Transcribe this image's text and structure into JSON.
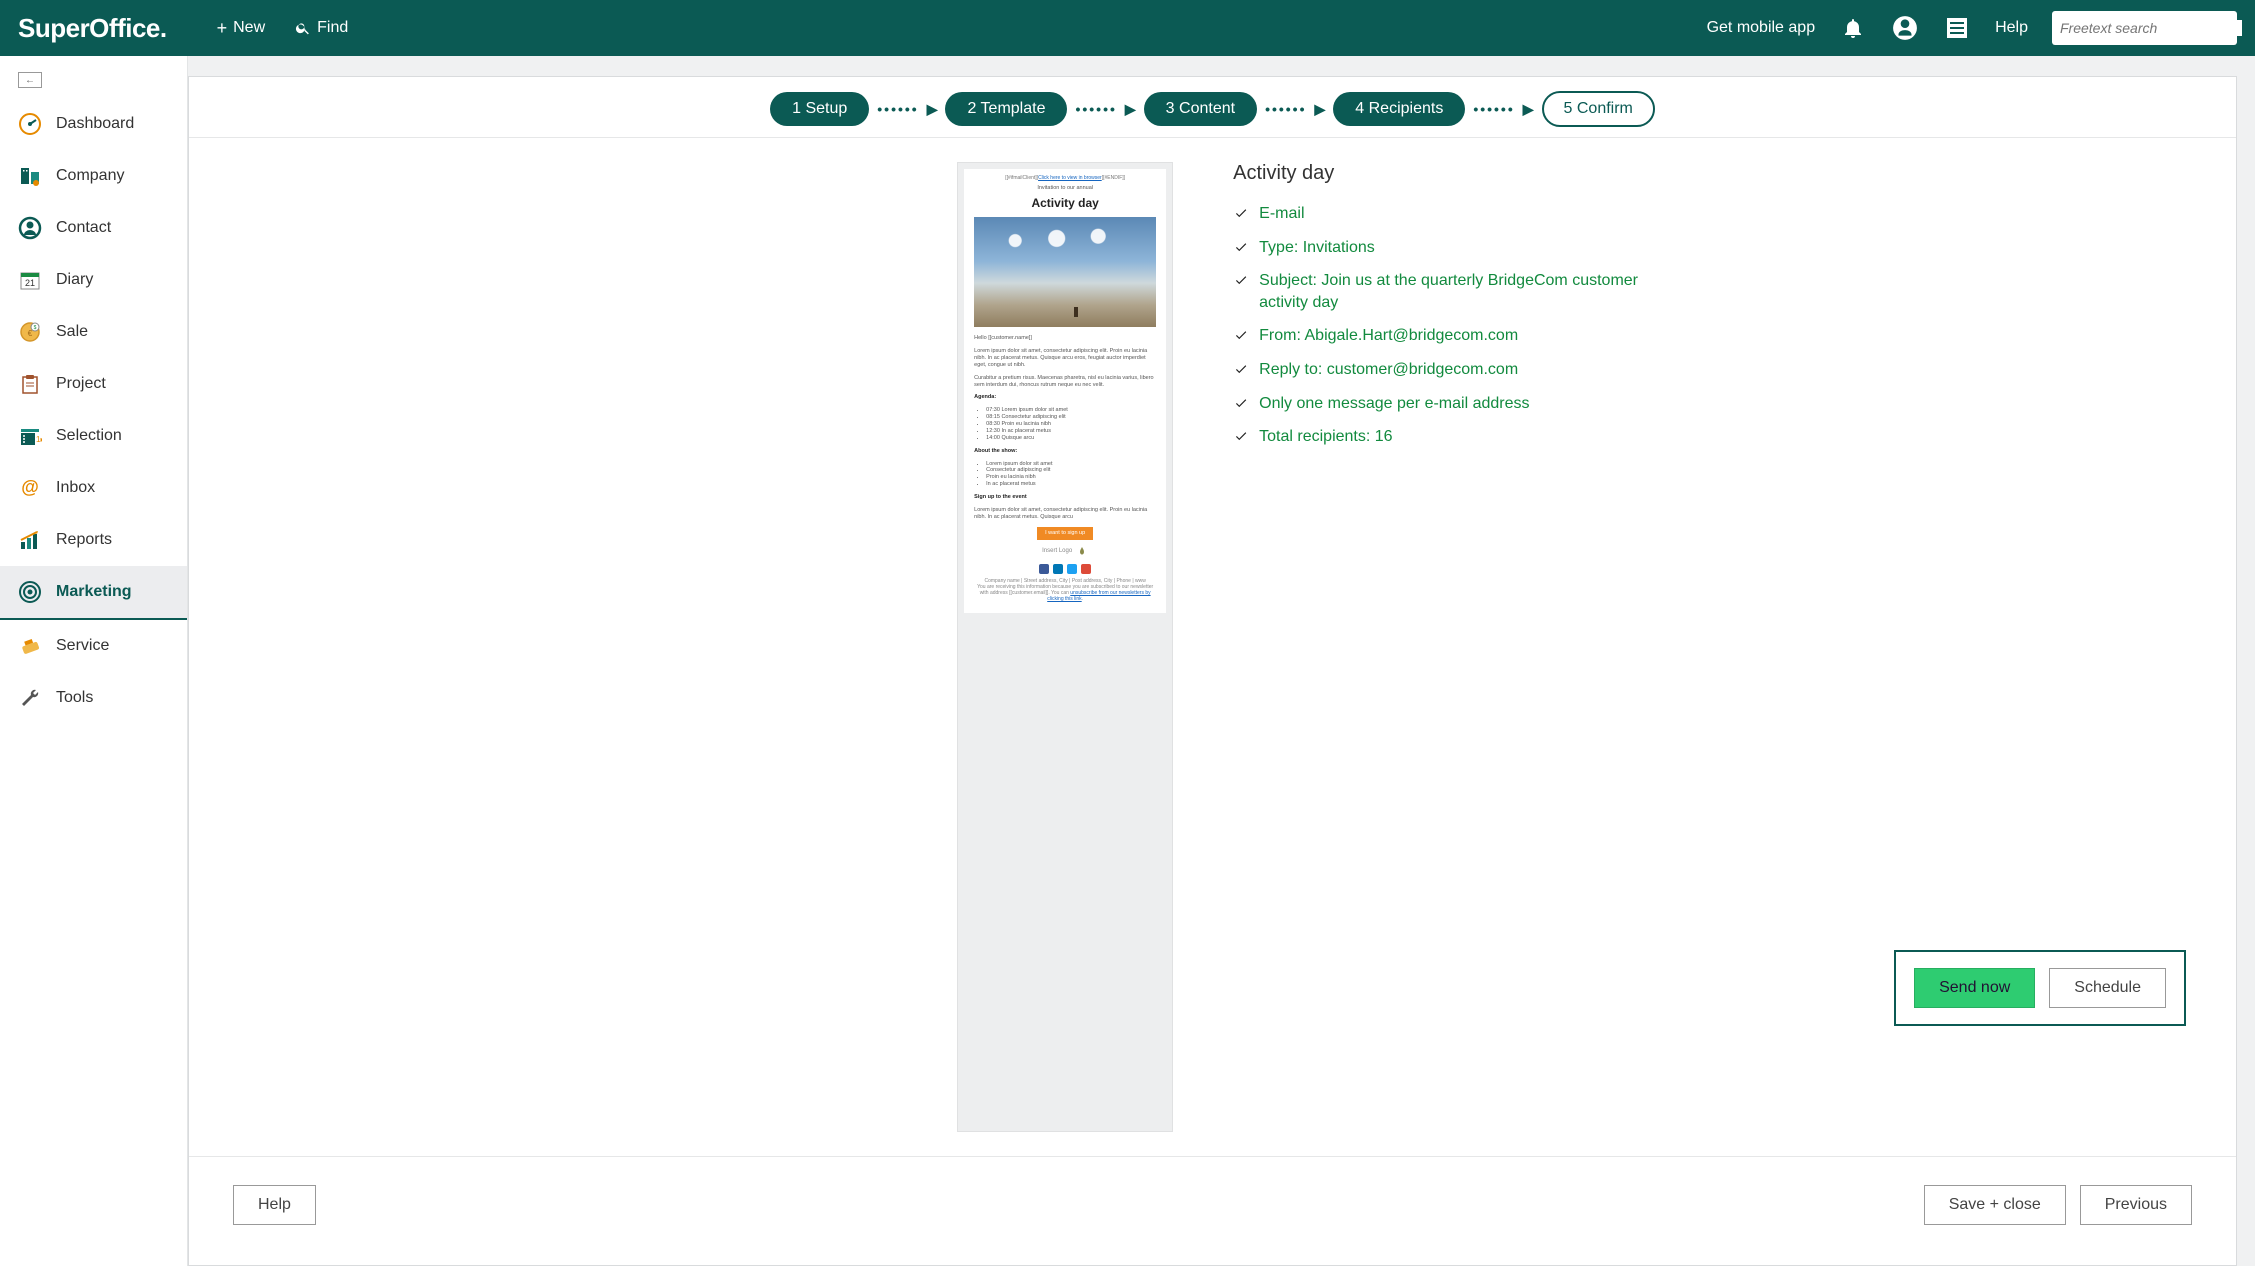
{
  "topbar": {
    "logo_text": "SuperOffice",
    "logo_suffix": ".",
    "new_label": "New",
    "find_label": "Find",
    "mobile_label": "Get mobile app",
    "help_label": "Help",
    "search_placeholder": "Freetext search"
  },
  "sidebar": {
    "items": [
      {
        "label": "Dashboard"
      },
      {
        "label": "Company"
      },
      {
        "label": "Contact"
      },
      {
        "label": "Diary"
      },
      {
        "label": "Sale"
      },
      {
        "label": "Project"
      },
      {
        "label": "Selection"
      },
      {
        "label": "Inbox"
      },
      {
        "label": "Reports"
      },
      {
        "label": "Marketing"
      },
      {
        "label": "Service"
      },
      {
        "label": "Tools"
      }
    ],
    "active_index": 9
  },
  "steps": [
    "1 Setup",
    "2 Template",
    "3 Content",
    "4 Recipients",
    "5 Confirm"
  ],
  "summary": {
    "title": "Activity day",
    "lines": [
      "E-mail",
      "Type: Invitations",
      "Subject: Join us at the quarterly BridgeCom customer activity day",
      "From: Abigale.Hart@bridgecom.com",
      "Reply to: customer@bridgecom.com",
      "Only one message per e-mail address",
      "Total recipients: 16"
    ]
  },
  "preview": {
    "browser_link_prefix": "[[#ifmailClient]]",
    "browser_link": "Click here to view in browser",
    "browser_link_suffix": "[[#ENDIF]]",
    "intro_line": "Invitation to our annual",
    "title": "Activity day",
    "greeting": "Hello [[customer.name]]",
    "para1": "Lorem ipsum dolor sit amet, consectetur adipiscing elit. Proin eu lacinia nibh. In ac placerat metus. Quisque arcu eros, feugiat auctor imperdiet eget, congue ut nibh.",
    "para2": "Curabitur a pretium risus. Maecenas pharetra, nisl eu lacinia varius, libero sem interdum dui, rhoncus rutrum neque eu nec velit.",
    "agenda_heading": "Agenda:",
    "agenda": [
      "07:30 Lorem ipsum dolor sit amet",
      "08:15 Consectetur adipiscing elit",
      "08:30 Proin eu lacinia nibh",
      "12:30 In ac placerat metus",
      "14:00 Quisque arcu"
    ],
    "show_heading": "About the show:",
    "show_items": [
      "Lorem ipsum dolor sit amet",
      "Consectetur adipiscing elit",
      "Proin eu lacinia nibh",
      "In ac placerat metus"
    ],
    "signup_heading": "Sign up to the event",
    "signup_para": "Lorem ipsum dolor sit amet, consectetur adipiscing elit. Proin eu lacinia nibh. In ac placerat metus. Quisque arcu",
    "cta": "I want to sign up",
    "logo_text": "Insert Logo",
    "footer_contact": "Company name  |  Street address, City  |  Post address, City  |  Phone  |  www",
    "footer_unsub_pre": "You are receiving this information because you are subscribed to our newsletter with address [[customer.email]]. You can ",
    "footer_unsub_link": "unsubscribe from our newsletters by clicking this link"
  },
  "buttons": {
    "send_now": "Send now",
    "schedule": "Schedule",
    "help": "Help",
    "save_close": "Save + close",
    "previous": "Previous"
  }
}
